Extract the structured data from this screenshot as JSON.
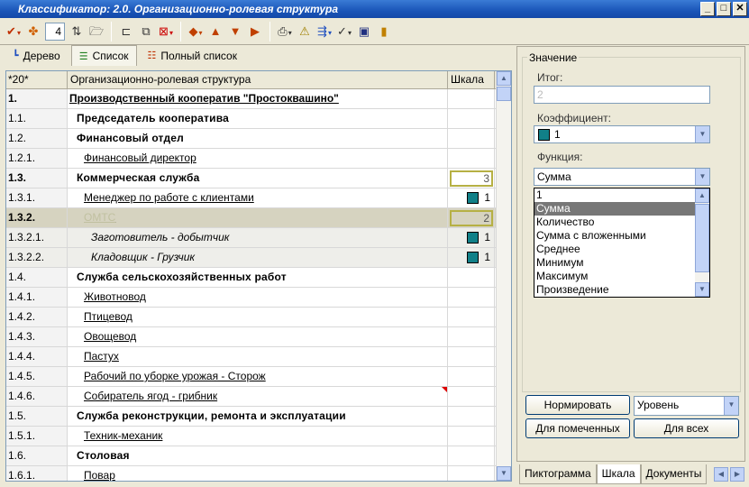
{
  "window": {
    "title": "Классификатор: 2.0. Организационно-ролевая структура",
    "min": "_",
    "max": "□",
    "close": "✕"
  },
  "toolbar": {
    "level_value": "4"
  },
  "view_tabs": [
    {
      "label": "Дерево",
      "icon": "tree-icon"
    },
    {
      "label": "Список",
      "icon": "list-icon"
    },
    {
      "label": "Полный список",
      "icon": "full-list-icon"
    }
  ],
  "grid": {
    "headers": [
      "*20*",
      "Организационно-ролевая структура",
      "Шкала"
    ],
    "rows": [
      {
        "code": "1.",
        "name": "Производственный кооператив \"Простоквашино\"",
        "level": 0,
        "scale": ""
      },
      {
        "code": "1.1.",
        "name": "Председатель кооператива",
        "level": 1,
        "scale": ""
      },
      {
        "code": "1.2.",
        "name": "Финансовый отдел",
        "level": 1,
        "scale": ""
      },
      {
        "code": "1.2.1.",
        "name": "Финансовый директор",
        "level": 2,
        "scale": ""
      },
      {
        "code": "1.3.",
        "name": "Коммерческая служба",
        "level": 1,
        "scale": "3"
      },
      {
        "code": "1.3.1.",
        "name": "Менеджер по работе с клиентами",
        "level": 2,
        "scale": "1"
      },
      {
        "code": "1.3.2.",
        "name": "ОМТС",
        "level": 2,
        "scale": "2"
      },
      {
        "code": "1.3.2.1.",
        "name": "Заготовитель - добытчик",
        "level": 3,
        "scale": "1"
      },
      {
        "code": "1.3.2.2.",
        "name": "Кладовщик - Грузчик",
        "level": 3,
        "scale": "1"
      },
      {
        "code": "1.4.",
        "name": "Служба сельскохозяйственных работ",
        "level": 1,
        "scale": ""
      },
      {
        "code": "1.4.1.",
        "name": "Животновод",
        "level": 2,
        "scale": ""
      },
      {
        "code": "1.4.2.",
        "name": "Птицевод",
        "level": 2,
        "scale": ""
      },
      {
        "code": "1.4.3.",
        "name": "Овощевод",
        "level": 2,
        "scale": ""
      },
      {
        "code": "1.4.4.",
        "name": "Пастух",
        "level": 2,
        "scale": ""
      },
      {
        "code": "1.4.5.",
        "name": "Рабочий по уборке урожая - Сторож",
        "level": 2,
        "scale": ""
      },
      {
        "code": "1.4.6.",
        "name": "Собиратель ягод - грибник",
        "level": 2,
        "scale": ""
      },
      {
        "code": "1.5.",
        "name": "Служба реконструкции, ремонта и эксплуатации",
        "level": 1,
        "scale": ""
      },
      {
        "code": "1.5.1.",
        "name": "Техник-механик",
        "level": 2,
        "scale": ""
      },
      {
        "code": "1.6.",
        "name": "Столовая",
        "level": 1,
        "scale": ""
      },
      {
        "code": "1.6.1.",
        "name": "Повар",
        "level": 2,
        "scale": ""
      }
    ]
  },
  "panel": {
    "group_title": "Значение",
    "total_label": "Итог:",
    "total_value": "2",
    "coef_label": "Коэффициент:",
    "coef_value": "1",
    "func_label": "Функция:",
    "func_value": "Сумма",
    "func_options": [
      "1",
      "Сумма",
      "Количество",
      "Сумма с вложенными",
      "Среднее",
      "Минимум",
      "Максимум",
      "Произведение"
    ],
    "normalize_button": "Нормировать",
    "level_select": "Уровень",
    "for_marked_button": "Для помеченных",
    "for_all_button": "Для всех",
    "bottom_tabs": [
      "Пиктограмма",
      "Шкала",
      "Документы"
    ],
    "accent_color": "#118088"
  }
}
